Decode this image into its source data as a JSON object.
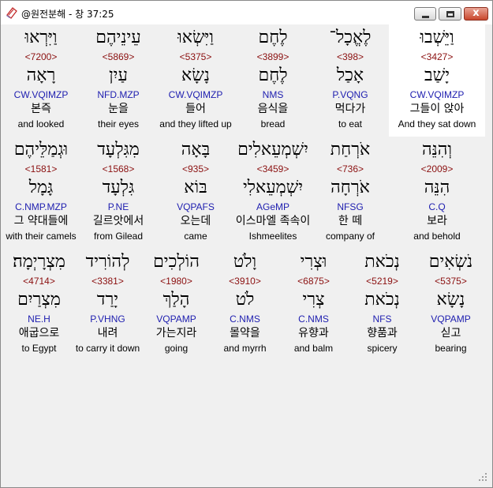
{
  "window": {
    "title": "@원전분해 - 창 37:25",
    "icons": {
      "app": "app-book-icon",
      "minimize": "minimize-icon",
      "maximize": "maximize-icon",
      "close": "close-icon"
    },
    "close_glyph": "x"
  },
  "colors": {
    "strong": "#8b1010",
    "parse": "#2020b0",
    "selected_bg": "#ffffff"
  },
  "rows": [
    {
      "words": [
        {
          "surface": "וַיֵּשְׁבוּ",
          "strong": "<3427>",
          "lemma": "יָשַׁב",
          "parse": "CW.VQIMZP",
          "korean": "그들이 앉아",
          "english": "And they sat down",
          "selected": true
        },
        {
          "surface": "לֶאֱכָל־",
          "strong": "<398>",
          "lemma": "אָכַל",
          "parse": "P.VQNG",
          "korean": "먹다가",
          "english": "to eat",
          "selected": false
        },
        {
          "surface": "לֶחֶם",
          "strong": "<3899>",
          "lemma": "לֶחֶם",
          "parse": "NMS",
          "korean": "음식을",
          "english": "bread",
          "selected": false
        },
        {
          "surface": "וַיִּשְׂאוּ",
          "strong": "<5375>",
          "lemma": "נָשָׂא",
          "parse": "CW.VQIMZP",
          "korean": "들어",
          "english": "and they lifted up",
          "selected": false
        },
        {
          "surface": "עֵינֵיהֶם",
          "strong": "<5869>",
          "lemma": "עַיִן",
          "parse": "NFD.MZP",
          "korean": "눈을",
          "english": "their eyes",
          "selected": false
        },
        {
          "surface": "וַיִּרְאוּ",
          "strong": "<7200>",
          "lemma": "רָאָה",
          "parse": "CW.VQIMZP",
          "korean": "본즉",
          "english": "and looked",
          "selected": false
        }
      ]
    },
    {
      "words": [
        {
          "surface": "וְהִנֵּה",
          "strong": "<2009>",
          "lemma": "הִנֵּה",
          "parse": "C.Q",
          "korean": "보라",
          "english": "and behold",
          "selected": false
        },
        {
          "surface": "אֹרְחַת",
          "strong": "<736>",
          "lemma": "אֹרְחָה",
          "parse": "NFSG",
          "korean": "한 떼",
          "english": "company of",
          "selected": false
        },
        {
          "surface": "יִשְׁמְעֵאלִים",
          "strong": "<3459>",
          "lemma": "יִשְׁמְעֵאלִי",
          "parse": "AGeMP",
          "korean": "이스마엘 족속이",
          "english": "Ishmeelites",
          "selected": false
        },
        {
          "surface": "בָּאָה",
          "strong": "<935>",
          "lemma": "בּוֹא",
          "parse": "VQPAFS",
          "korean": "오는데",
          "english": "came",
          "selected": false
        },
        {
          "surface": "מִגִּלְעָד",
          "strong": "<1568>",
          "lemma": "גִּלְעָד",
          "parse": "P.NE",
          "korean": "길르앗에서",
          "english": "from Gilead",
          "selected": false
        },
        {
          "surface": "וּגְמַלֵּיהֶם",
          "strong": "<1581>",
          "lemma": "גָּמָל",
          "parse": "C.NMP.MZP",
          "korean": "그 약대들에",
          "english": "with their camels",
          "selected": false
        }
      ]
    },
    {
      "words": [
        {
          "surface": "נֹשְׂאִים",
          "strong": "<5375>",
          "lemma": "נָשָׂא",
          "parse": "VQPAMP",
          "korean": "싣고",
          "english": "bearing",
          "selected": false
        },
        {
          "surface": "נְכֹאת",
          "strong": "<5219>",
          "lemma": "נְכֹאת",
          "parse": "NFS",
          "korean": "향품과",
          "english": "spicery",
          "selected": false
        },
        {
          "surface": "וּצְרִי",
          "strong": "<6875>",
          "lemma": "צְרִי",
          "parse": "C.NMS",
          "korean": "유향과",
          "english": "and balm",
          "selected": false
        },
        {
          "surface": "וָלֹט",
          "strong": "<3910>",
          "lemma": "לֹט",
          "parse": "C.NMS",
          "korean": "몰약을",
          "english": "and myrrh",
          "selected": false
        },
        {
          "surface": "הוֹלְכִים",
          "strong": "<1980>",
          "lemma": "הָלַךְ",
          "parse": "VQPAMP",
          "korean": "가는지라",
          "english": "going",
          "selected": false
        },
        {
          "surface": "לְהוֹרִיד",
          "strong": "<3381>",
          "lemma": "יָרַד",
          "parse": "P.VHNG",
          "korean": "내려",
          "english": "to carry it down",
          "selected": false
        },
        {
          "surface": "מִצְרָיְמָה׃",
          "strong": "<4714>",
          "lemma": "מִצְרַיִם",
          "parse": "NE.H",
          "korean": "애굽으로",
          "english": "to Egypt",
          "selected": false
        }
      ]
    }
  ]
}
